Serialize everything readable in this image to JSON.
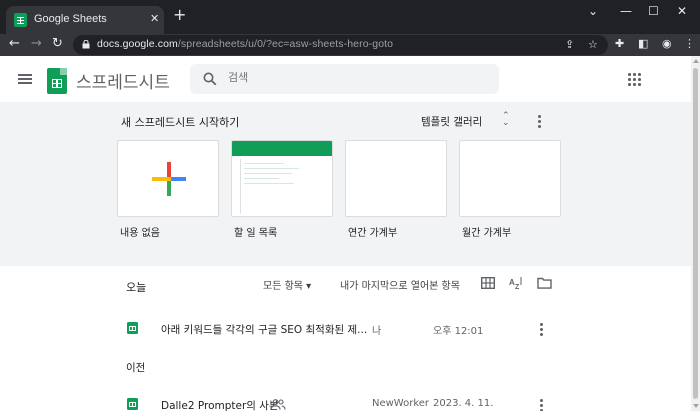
{
  "browser": {
    "tab_title": "Google Sheets",
    "new_tab": "+",
    "url_host": "docs.google.com",
    "url_path": "/spreadsheets/u/0/?ec=asw-sheets-hero-goto",
    "controls": {
      "minimize": "—",
      "maximize": "☐",
      "close": "✕"
    }
  },
  "header": {
    "app_name": "스프레드시트",
    "search_placeholder": "검색"
  },
  "gallery": {
    "title": "새 스프레드시트 시작하기",
    "template_gallery": "템플릿 갤러리",
    "templates": [
      {
        "label": "내용 없음",
        "icon": "blank-plus"
      },
      {
        "label": "할 일 목록",
        "icon": "todo-thumbnail"
      },
      {
        "label": "연간 가계부",
        "icon": "blank-thumbnail"
      },
      {
        "label": "월간 가계부",
        "icon": "blank-thumbnail"
      }
    ]
  },
  "list": {
    "section_today": "오늘",
    "owner_filter": "모든 항목",
    "sort_by": "내가 마지막으로 열어본 항목",
    "section_earlier": "이전",
    "files": [
      {
        "name": "아래 키워드들 각각의 구글 SEO 최적화된 제...",
        "owner": "나",
        "date": "오후 12:01",
        "shared": false
      },
      {
        "name": "Dalle2 Prompter의 사본",
        "owner": "NewWorker",
        "date": "2023. 4. 11.",
        "shared": true
      }
    ]
  },
  "colors": {
    "sheets_green": "#0f9d58",
    "gallery_bg": "#f1f3f4",
    "chrome_dark": "#202124"
  }
}
